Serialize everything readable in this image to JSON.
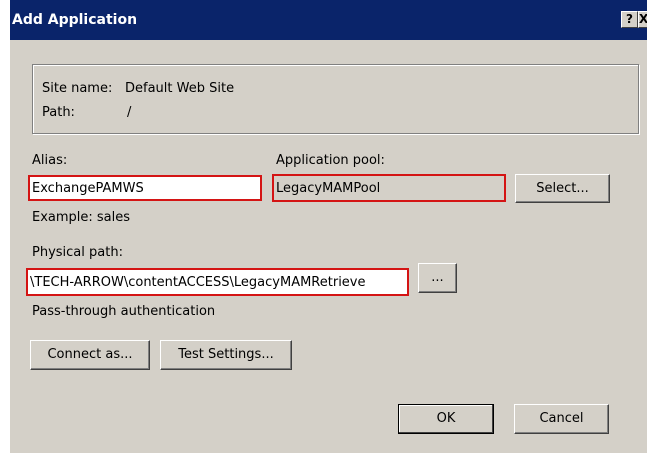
{
  "window": {
    "title": "Add Application",
    "help_label": "?",
    "close_label": "X"
  },
  "site_info": {
    "site_name_label": "Site name:",
    "site_name_value": "Default Web Site",
    "path_label": "Path:",
    "path_value": "/"
  },
  "alias": {
    "label": "Alias:",
    "value": "ExchangePAMWS",
    "example": "Example: sales"
  },
  "app_pool": {
    "label": "Application pool:",
    "value": "LegacyMAMPool",
    "select_label": "Select..."
  },
  "physical_path": {
    "label": "Physical path:",
    "value": "\\TECH-ARROW\\contentACCESS\\LegacyMAMRetrieve",
    "browse_label": "..."
  },
  "auth": {
    "label": "Pass-through authentication",
    "connect_as_label": "Connect as...",
    "test_settings_label": "Test Settings..."
  },
  "footer": {
    "ok_label": "OK",
    "cancel_label": "Cancel"
  },
  "colors": {
    "titlebar": "#0a246a",
    "dialog_bg": "#d4d0c8",
    "highlight_border": "#d41414"
  }
}
